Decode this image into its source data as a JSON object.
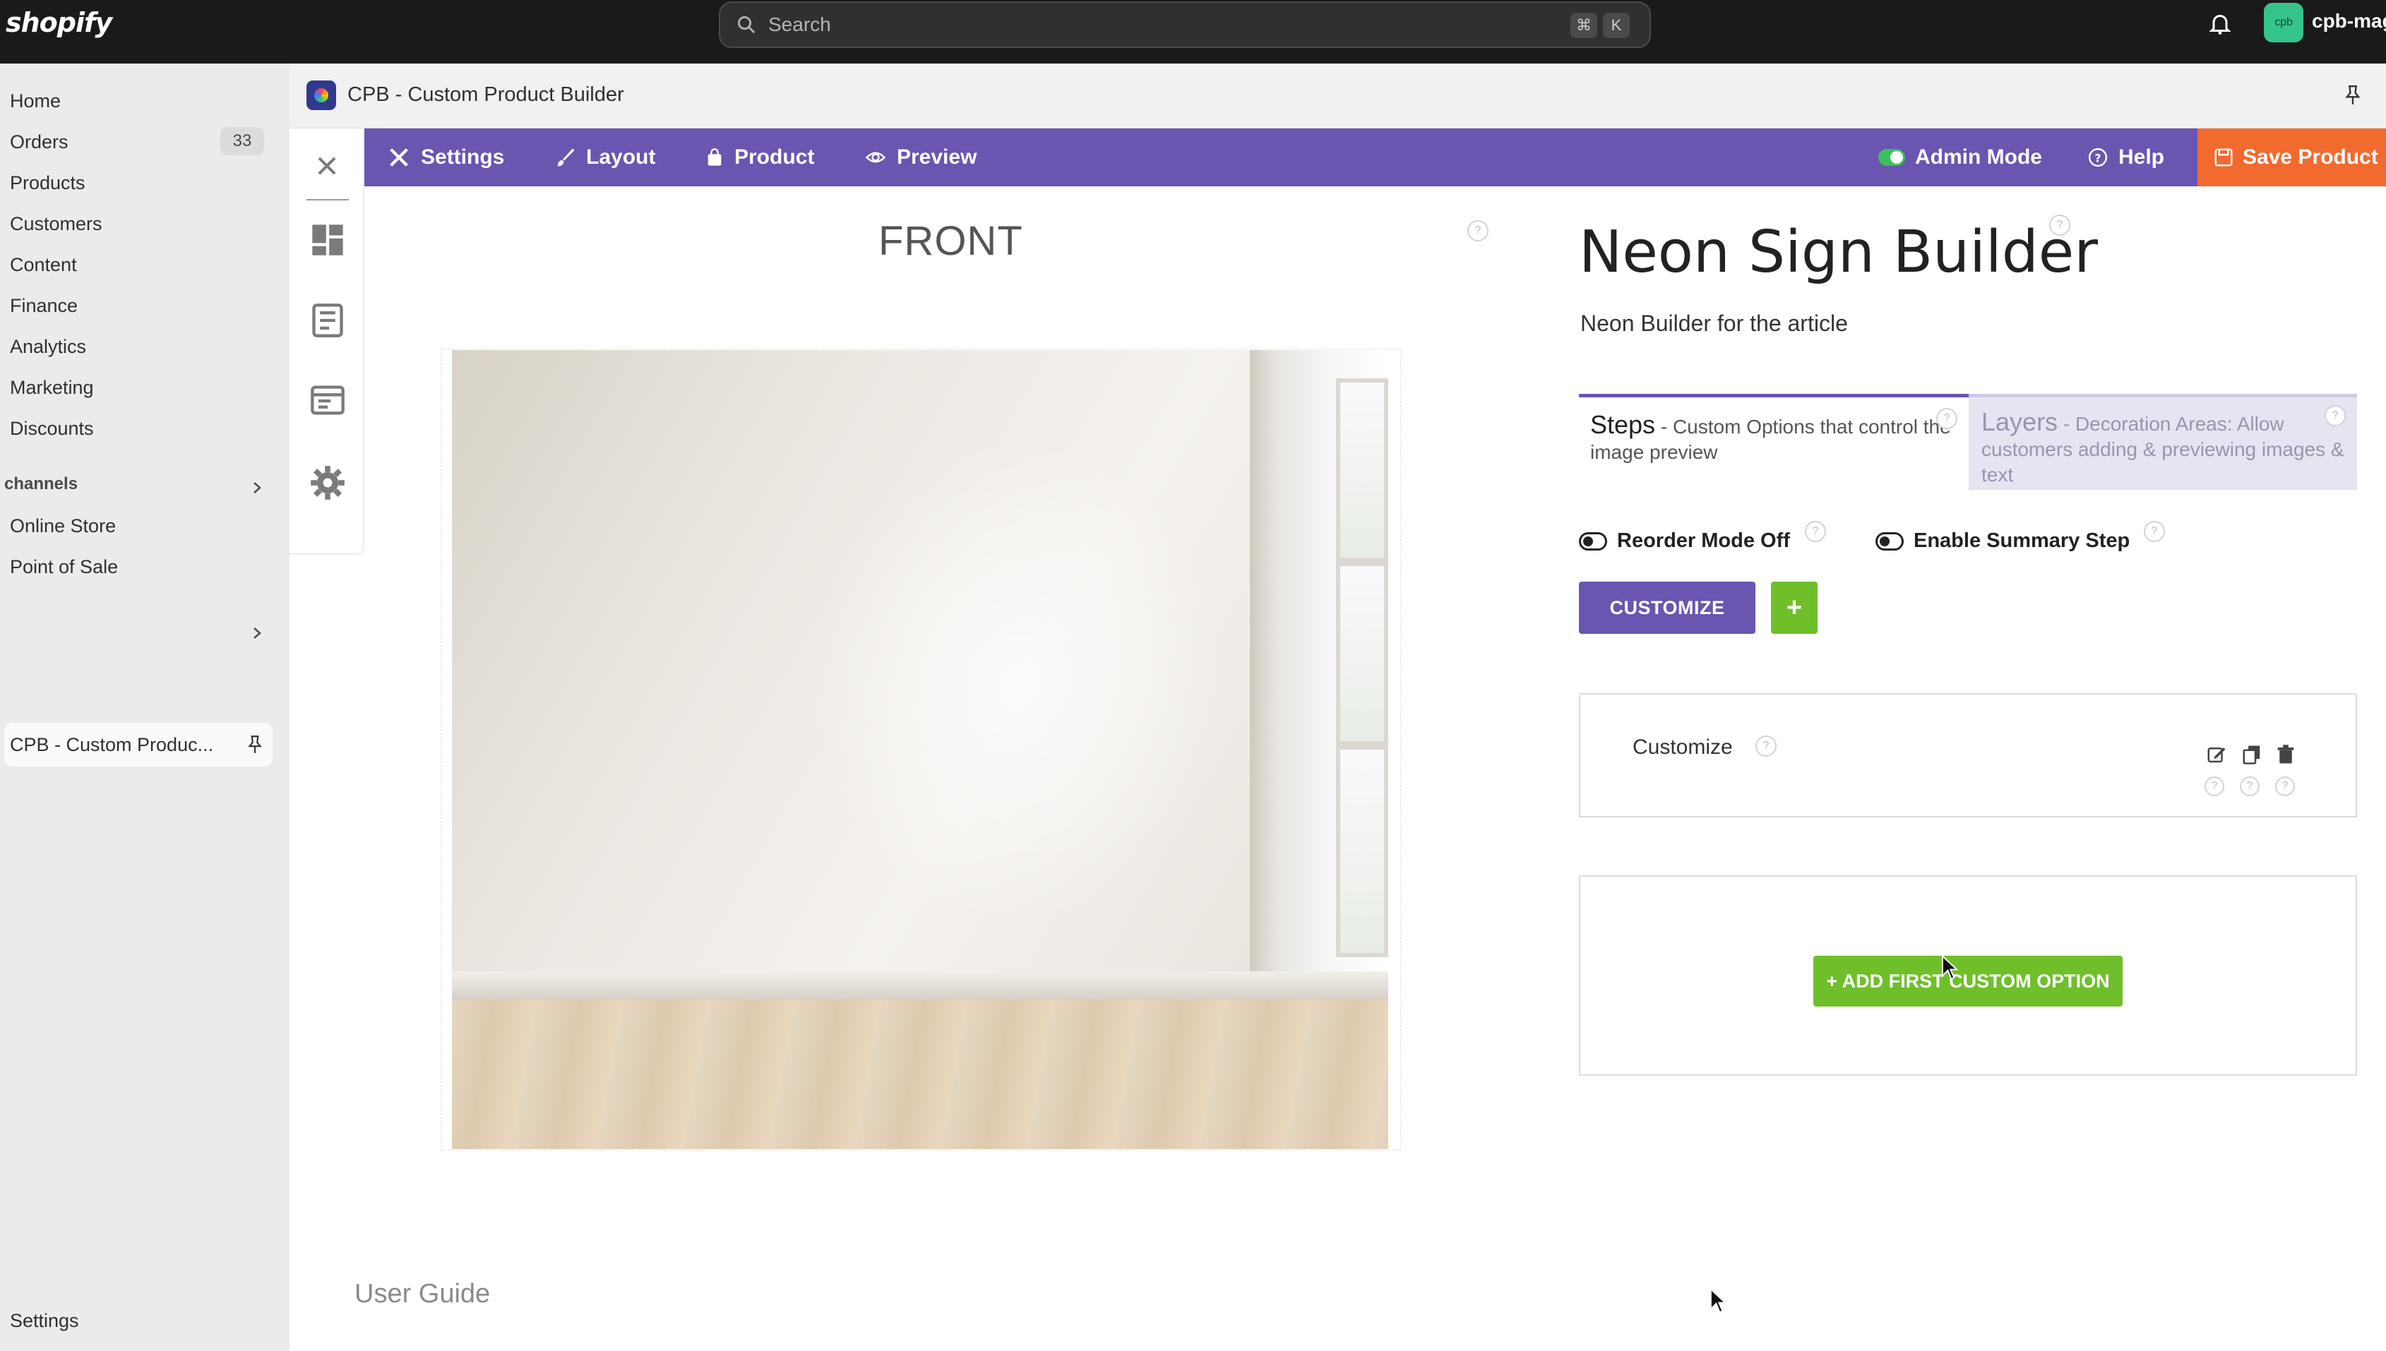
{
  "topbar": {
    "logo": "shopify",
    "search_placeholder": "Search",
    "shortcut_keys": [
      "⌘",
      "K"
    ],
    "avatar_initials": "cpb",
    "store_name": "cpb-mag",
    "avatar_color": "#35c48a"
  },
  "sidebar": {
    "items": [
      {
        "label": "Home"
      },
      {
        "label": "Orders",
        "badge": "33"
      },
      {
        "label": "Products"
      },
      {
        "label": "Customers"
      },
      {
        "label": "Content"
      },
      {
        "label": "Finance"
      },
      {
        "label": "Analytics"
      },
      {
        "label": "Marketing"
      },
      {
        "label": "Discounts"
      }
    ],
    "channels_label": "channels",
    "channels": [
      {
        "label": "Online Store"
      },
      {
        "label": "Point of Sale"
      }
    ],
    "pinned_app": "CPB - Custom Produc...",
    "settings_label": "Settings"
  },
  "app": {
    "title": "CPB - Custom Product Builder",
    "toolbar": {
      "settings": "Settings",
      "layout": "Layout",
      "product": "Product",
      "preview": "Preview",
      "admin_mode": "Admin Mode",
      "help": "Help",
      "save_product": "Save Product"
    },
    "colors": {
      "toolbar": "#6a55b0",
      "save": "#f26a2e",
      "green": "#6fbf2a"
    }
  },
  "canvas": {
    "view_label": "FRONT",
    "user_guide": "User Guide"
  },
  "product": {
    "title": "Neon Sign Builder",
    "subtitle": "Neon Builder for the article",
    "tabs": {
      "steps_title": "Steps",
      "steps_desc": " - Custom Options that control the image preview",
      "layers_title": "Layers",
      "layers_desc": " - Decoration Areas: Allow customers adding & previewing images & text"
    },
    "reorder_mode": "Reorder Mode Off",
    "enable_summary": "Enable Summary Step",
    "customize_button": "CUSTOMIZE",
    "plus_button": "+",
    "step_label": "Customize",
    "add_option": "+ ADD FIRST CUSTOM OPTION",
    "help_mark": "?"
  }
}
